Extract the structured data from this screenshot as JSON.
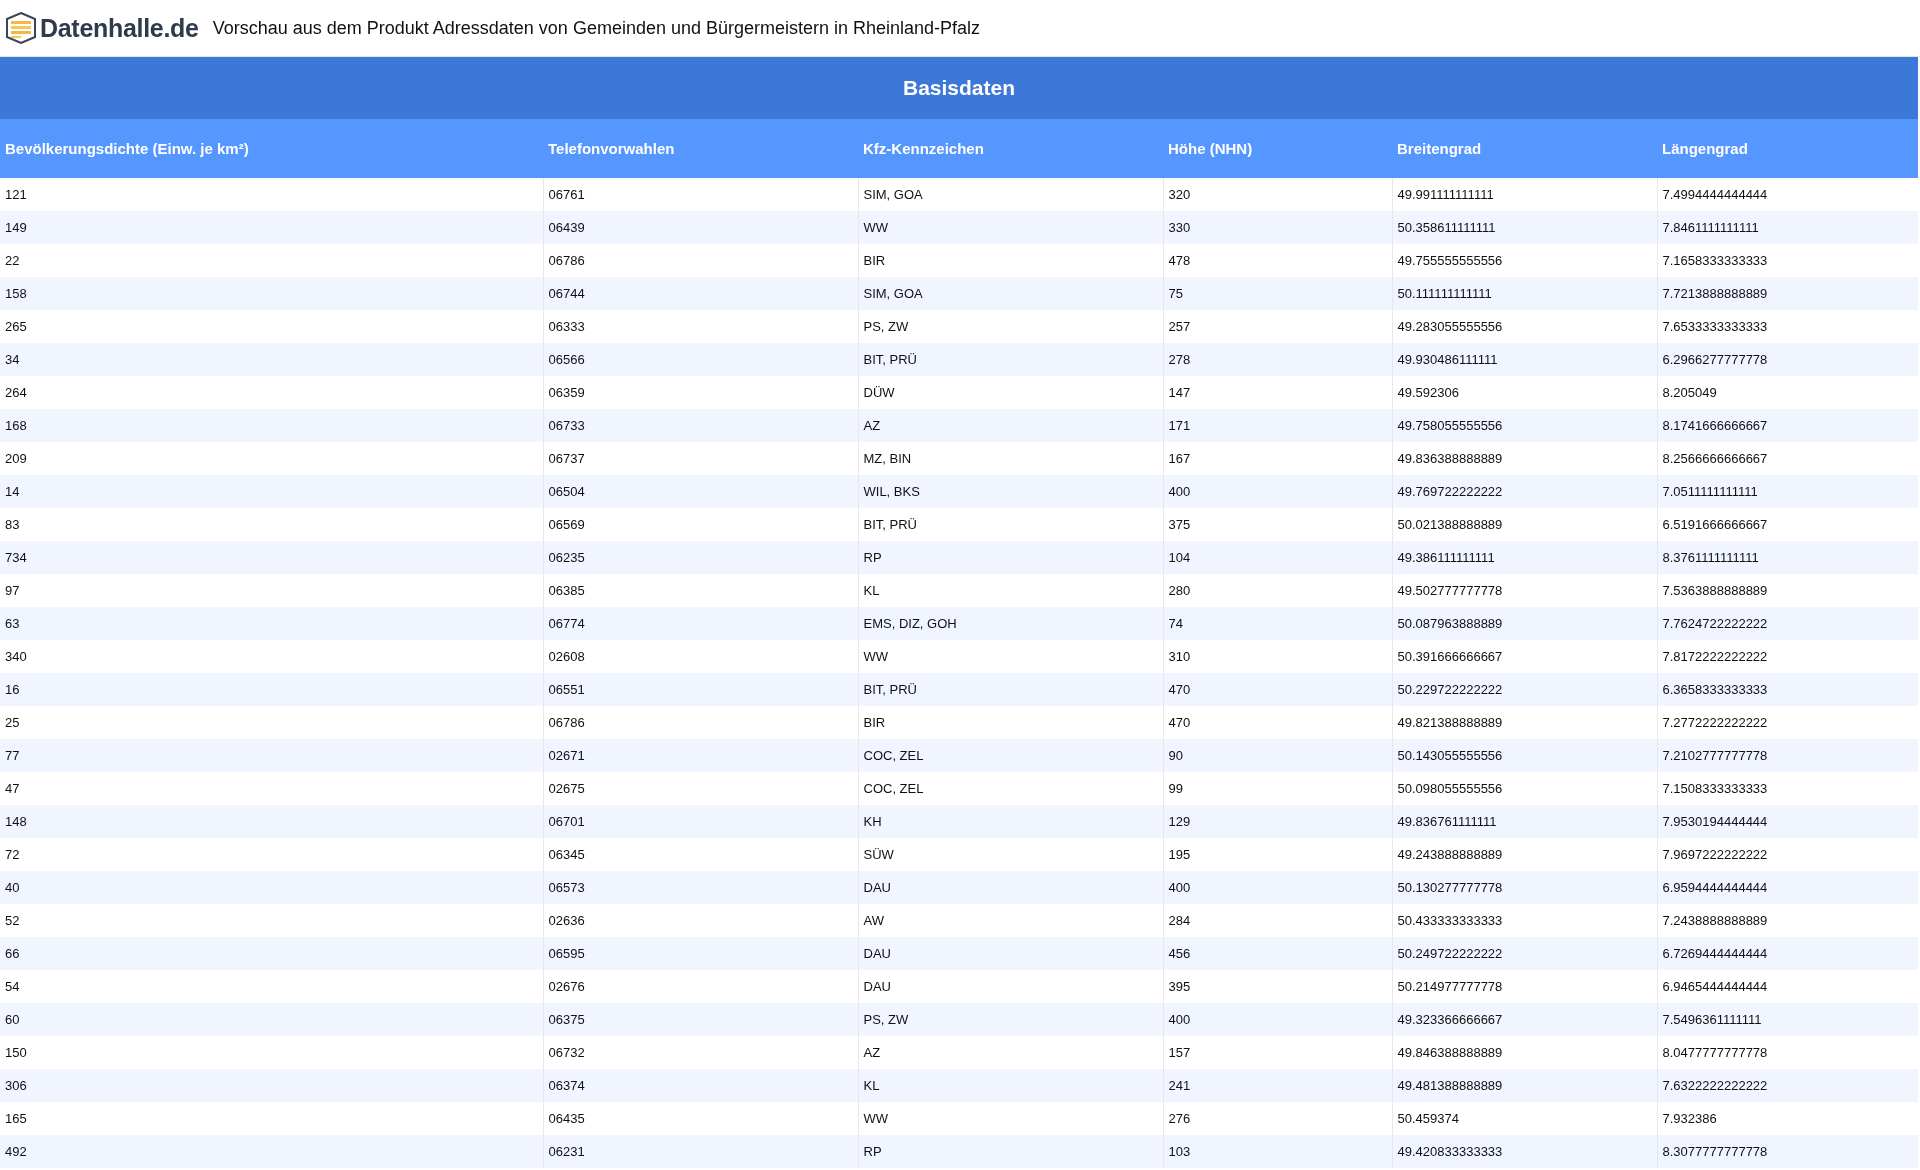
{
  "header": {
    "logo_text": "Datenhalle.de",
    "title": "Vorschau aus dem Produkt Adressdaten von Gemeinden und Bürgermeistern in Rheinland-Pfalz"
  },
  "table": {
    "group_title": "Basisdaten",
    "columns": [
      "Bevölkerungsdichte (Einw. je km²)",
      "Telefonvorwahlen",
      "Kfz-Kennzeichen",
      "Höhe (NHN)",
      "Breitengrad",
      "Längengrad"
    ],
    "rows": [
      [
        "121",
        "06761",
        "SIM, GOA",
        "320",
        "49.991111111111",
        "7.4994444444444"
      ],
      [
        "149",
        "06439",
        "WW",
        "330",
        "50.358611111111",
        "7.8461111111111"
      ],
      [
        "22",
        "06786",
        "BIR",
        "478",
        "49.755555555556",
        "7.1658333333333"
      ],
      [
        "158",
        "06744",
        "SIM, GOA",
        "75",
        "50.111111111111",
        "7.7213888888889"
      ],
      [
        "265",
        "06333",
        "PS, ZW",
        "257",
        "49.283055555556",
        "7.6533333333333"
      ],
      [
        "34",
        "06566",
        "BIT, PRÜ",
        "278",
        "49.930486111111",
        "6.2966277777778"
      ],
      [
        "264",
        "06359",
        "DÜW",
        "147",
        "49.592306",
        "8.205049"
      ],
      [
        "168",
        "06733",
        "AZ",
        "171",
        "49.758055555556",
        "8.1741666666667"
      ],
      [
        "209",
        "06737",
        "MZ, BIN",
        "167",
        "49.836388888889",
        "8.2566666666667"
      ],
      [
        "14",
        "06504",
        "WIL, BKS",
        "400",
        "49.769722222222",
        "7.0511111111111"
      ],
      [
        "83",
        "06569",
        "BIT, PRÜ",
        "375",
        "50.021388888889",
        "6.5191666666667"
      ],
      [
        "734",
        "06235",
        "RP",
        "104",
        "49.386111111111",
        "8.3761111111111"
      ],
      [
        "97",
        "06385",
        "KL",
        "280",
        "49.502777777778",
        "7.5363888888889"
      ],
      [
        "63",
        "06774",
        "EMS, DIZ, GOH",
        "74",
        "50.087963888889",
        "7.7624722222222"
      ],
      [
        "340",
        "02608",
        "WW",
        "310",
        "50.391666666667",
        "7.8172222222222"
      ],
      [
        "16",
        "06551",
        "BIT, PRÜ",
        "470",
        "50.229722222222",
        "6.3658333333333"
      ],
      [
        "25",
        "06786",
        "BIR",
        "470",
        "49.821388888889",
        "7.2772222222222"
      ],
      [
        "77",
        "02671",
        "COC, ZEL",
        "90",
        "50.143055555556",
        "7.2102777777778"
      ],
      [
        "47",
        "02675",
        "COC, ZEL",
        "99",
        "50.098055555556",
        "7.1508333333333"
      ],
      [
        "148",
        "06701",
        "KH",
        "129",
        "49.836761111111",
        "7.9530194444444"
      ],
      [
        "72",
        "06345",
        "SÜW",
        "195",
        "49.243888888889",
        "7.9697222222222"
      ],
      [
        "40",
        "06573",
        "DAU",
        "400",
        "50.130277777778",
        "6.9594444444444"
      ],
      [
        "52",
        "02636",
        "AW",
        "284",
        "50.433333333333",
        "7.2438888888889"
      ],
      [
        "66",
        "06595",
        "DAU",
        "456",
        "50.249722222222",
        "6.7269444444444"
      ],
      [
        "54",
        "02676",
        "DAU",
        "395",
        "50.214977777778",
        "6.9465444444444"
      ],
      [
        "60",
        "06375",
        "PS, ZW",
        "400",
        "49.323366666667",
        "7.5496361111111"
      ],
      [
        "150",
        "06732",
        "AZ",
        "157",
        "49.846388888889",
        "8.0477777777778"
      ],
      [
        "306",
        "06374",
        "KL",
        "241",
        "49.481388888889",
        "7.6322222222222"
      ],
      [
        "165",
        "06435",
        "WW",
        "276",
        "50.459374",
        "7.932386"
      ],
      [
        "492",
        "06231",
        "RP",
        "103",
        "49.420833333333",
        "8.3077777777778"
      ]
    ]
  }
}
